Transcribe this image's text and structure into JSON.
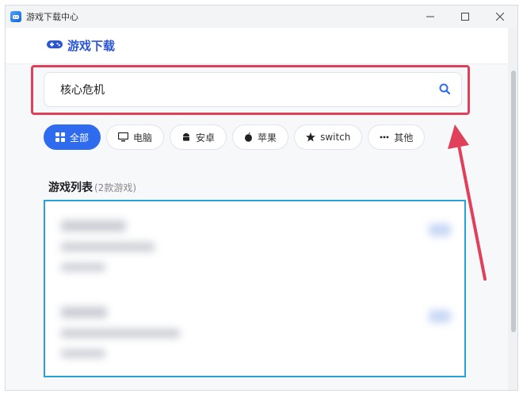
{
  "window": {
    "title": "游戏下载中心"
  },
  "header": {
    "brand": "游戏下载"
  },
  "search": {
    "value": "核心危机",
    "placeholder": ""
  },
  "filters": [
    {
      "label": "全部",
      "icon": "grid-icon",
      "active": true
    },
    {
      "label": "电脑",
      "icon": "monitor-icon",
      "active": false
    },
    {
      "label": "安卓",
      "icon": "android-icon",
      "active": false
    },
    {
      "label": "苹果",
      "icon": "apple-icon",
      "active": false
    },
    {
      "label": "switch",
      "icon": "star-icon",
      "active": false
    },
    {
      "label": "其他",
      "icon": "more-icon",
      "active": false
    }
  ],
  "list": {
    "title": "游戏列表",
    "count": "(2款游戏)"
  },
  "colors": {
    "accent": "#2f6bef",
    "highlight": "#e0405a",
    "frame": "#2aa0d8"
  }
}
